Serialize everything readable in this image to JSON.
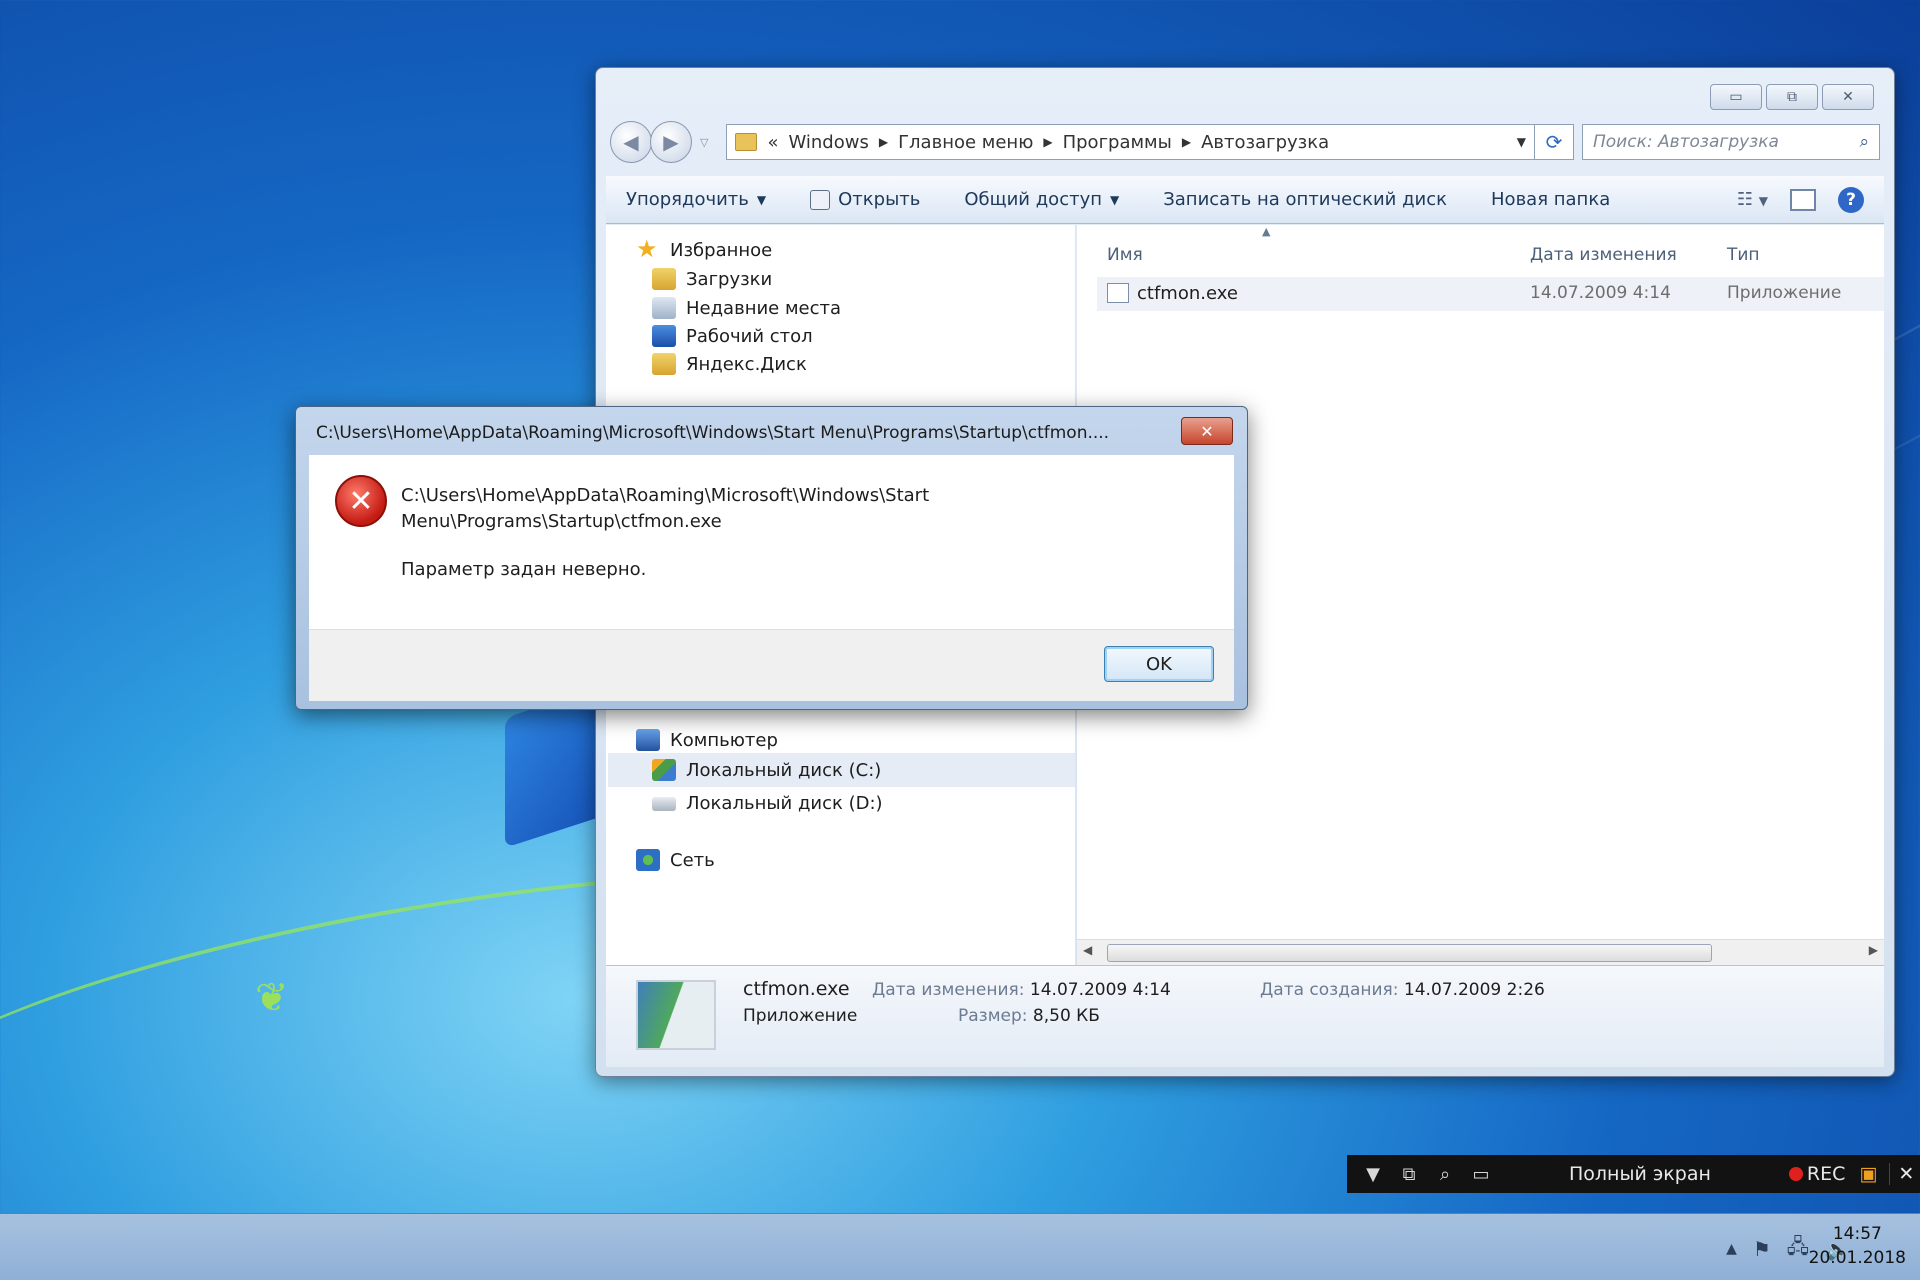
{
  "explorer": {
    "window_buttons": {
      "minimize": "▭",
      "maximize": "⧉",
      "close": "✕"
    },
    "address": {
      "prefix": "«",
      "crumbs": [
        "Windows",
        "Главное меню",
        "Программы",
        "Автозагрузка"
      ]
    },
    "search_placeholder": "Поиск: Автозагрузка",
    "toolbar": {
      "organize": "Упорядочить",
      "open": "Открыть",
      "share": "Общий доступ",
      "burn": "Записать на оптический диск",
      "new_folder": "Новая папка"
    },
    "nav": {
      "favorites": "Избранное",
      "downloads": "Загрузки",
      "recent": "Недавние места",
      "desktop": "Рабочий стол",
      "yandex": "Яндекс.Диск",
      "computer": "Компьютер",
      "disk_c": "Локальный диск (C:)",
      "disk_d": "Локальный диск (D:)",
      "network": "Сеть"
    },
    "columns": {
      "name": "Имя",
      "date": "Дата изменения",
      "type": "Тип"
    },
    "files": [
      {
        "name": "ctfmon.exe",
        "date": "14.07.2009 4:14",
        "type": "Приложение"
      }
    ],
    "details": {
      "name": "ctfmon.exe",
      "kind": "Приложение",
      "modified_label": "Дата изменения:",
      "modified_value": "14.07.2009 4:14",
      "size_label": "Размер:",
      "size_value": "8,50 КБ",
      "created_label": "Дата создания:",
      "created_value": "14.07.2009 2:26"
    }
  },
  "dialog": {
    "title": "C:\\Users\\Home\\AppData\\Roaming\\Microsoft\\Windows\\Start Menu\\Programs\\Startup\\ctfmon....",
    "path_line1": "C:\\Users\\Home\\AppData\\Roaming\\Microsoft\\Windows\\Start",
    "path_line2": "Menu\\Programs\\Startup\\ctfmon.exe",
    "message": "Параметр задан неверно.",
    "ok": "OK"
  },
  "recorder": {
    "fullscreen": "Полный экран",
    "rec": "REC"
  },
  "taskbar": {
    "time": "14:57",
    "date": "20.01.2018"
  }
}
